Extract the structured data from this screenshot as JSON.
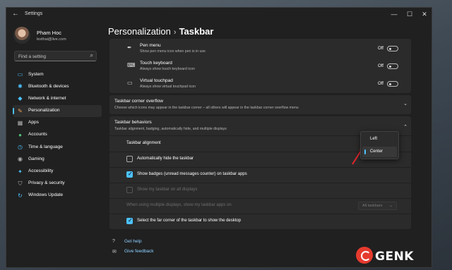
{
  "window": {
    "title": "Settings",
    "back": "←",
    "minimize": "—",
    "maximize": "☐",
    "close": "✕"
  },
  "profile": {
    "name": "Pham Hoc",
    "email": "lexthai@live.com"
  },
  "search": {
    "placeholder": "Find a setting"
  },
  "nav": [
    {
      "label": "System",
      "icon": "monitor-icon",
      "glyph": "▭",
      "color": "#4cc2ff"
    },
    {
      "label": "Bluetooth & devices",
      "icon": "bluetooth-icon",
      "glyph": "✱",
      "color": "#4cc2ff"
    },
    {
      "label": "Network & internet",
      "icon": "wifi-icon",
      "glyph": "◆",
      "color": "#4cc2ff"
    },
    {
      "label": "Personalization",
      "icon": "brush-icon",
      "glyph": "✎",
      "color": "#f0a35e"
    },
    {
      "label": "Apps",
      "icon": "apps-icon",
      "glyph": "▦",
      "color": "#b0b0b0"
    },
    {
      "label": "Accounts",
      "icon": "person-icon",
      "glyph": "●",
      "color": "#4ec27a"
    },
    {
      "label": "Time & language",
      "icon": "globe-clock-icon",
      "glyph": "◷",
      "color": "#4cc2ff"
    },
    {
      "label": "Gaming",
      "icon": "gamepad-icon",
      "glyph": "◉",
      "color": "#b0b0b0"
    },
    {
      "label": "Accessibility",
      "icon": "accessibility-icon",
      "glyph": "✦",
      "color": "#4cc2ff"
    },
    {
      "label": "Privacy & security",
      "icon": "shield-icon",
      "glyph": "⛉",
      "color": "#b0b0b0"
    },
    {
      "label": "Windows Update",
      "icon": "update-icon",
      "glyph": "↻",
      "color": "#4cc2ff"
    }
  ],
  "breadcrumb": {
    "parent": "Personalization",
    "separator": "›",
    "current": "Taskbar"
  },
  "corner_icons": [
    {
      "title": "Pen menu",
      "desc": "Show pen menu icon when pen is in use",
      "state": "Off",
      "icon": "pen-icon",
      "glyph": "✒"
    },
    {
      "title": "Touch keyboard",
      "desc": "Always show touch keyboard icon",
      "state": "Off",
      "icon": "keyboard-icon",
      "glyph": "⌨"
    },
    {
      "title": "Virtual touchpad",
      "desc": "Always show virtual touchpad icon",
      "state": "Off",
      "icon": "touchpad-icon",
      "glyph": "▭"
    }
  ],
  "overflow": {
    "title": "Taskbar corner overflow",
    "desc": "Choose which icons may appear in the taskbar corner – all others will appear in the taskbar corner overflow menu",
    "chevron": "⌄"
  },
  "behaviors": {
    "title": "Taskbar behaviors",
    "desc": "Taskbar alignment, badging, automatically hide, and multiple displays",
    "chevron": "⌃",
    "alignment_label": "Taskbar alignment",
    "auto_hide": "Automatically hide the taskbar",
    "badges": "Show badges (unread messages counter) on taskbar apps",
    "all_displays": "Show my taskbar on all displays",
    "multi_label": "When using multiple displays, show my taskbar apps on",
    "multi_value": "All taskbars",
    "multi_chevron": "⌄",
    "far_corner": "Select the far corner of the taskbar to show the desktop"
  },
  "alignment_menu": {
    "options": [
      "Left",
      "Center"
    ],
    "selected": "Center"
  },
  "links": {
    "help": "Get help",
    "feedback": "Give feedback",
    "help_glyph": "?",
    "feedback_glyph": "✉"
  },
  "watermark": {
    "text": "GENK"
  },
  "colors": {
    "accent": "#4cc2ff",
    "annotation_arrow": "#e3262d"
  }
}
